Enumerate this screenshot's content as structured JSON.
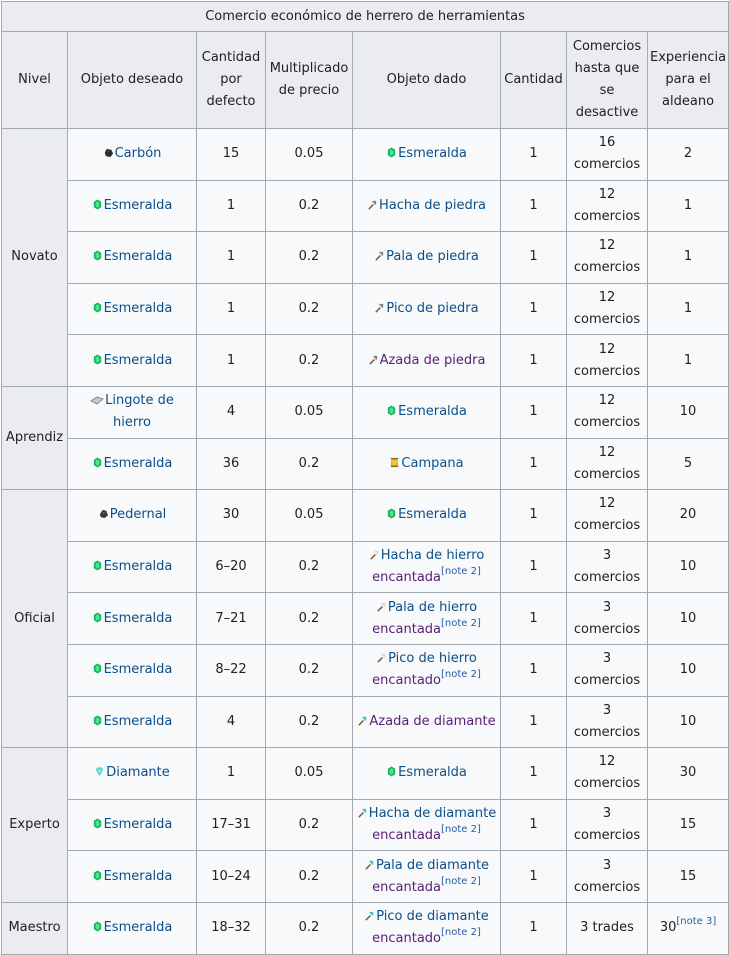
{
  "title": "Comercio económico de herrero de herramientas",
  "headers": {
    "nivel": "Nivel",
    "objeto_deseado": "Objeto deseado",
    "cantidad_defecto": [
      "Cantidad",
      "por",
      "defecto"
    ],
    "multiplicado": [
      "Multiplicado",
      "de precio"
    ],
    "objeto_dado": "Objeto dado",
    "cantidad": "Cantidad",
    "comercios": [
      "Comercios",
      "hasta que",
      "se",
      "desactive"
    ],
    "experiencia": [
      "Experiencia",
      "para el",
      "aldeano"
    ]
  },
  "levels": [
    {
      "name": "Novato",
      "rows": 5
    },
    {
      "name": "Aprendiz",
      "rows": 2
    },
    {
      "name": "Oficial",
      "rows": 5
    },
    {
      "name": "Experto",
      "rows": 3
    },
    {
      "name": "Maestro",
      "rows": 1
    }
  ],
  "rows": [
    {
      "wanted": "Carbón",
      "wanted_icon": "coal-icon",
      "default_qty": "15",
      "multiplier": "0.05",
      "given": "Esmeralda",
      "given_icon": "emerald-icon",
      "given_note": "",
      "qty": "1",
      "trades": [
        "16",
        "comercios"
      ],
      "xp": "2",
      "xp_note": ""
    },
    {
      "wanted": "Esmeralda",
      "wanted_icon": "emerald-icon",
      "default_qty": "1",
      "multiplier": "0.2",
      "given": "Hacha de piedra",
      "given_icon": "stone-axe-icon",
      "given_note": "",
      "qty": "1",
      "trades": [
        "12",
        "comercios"
      ],
      "xp": "1",
      "xp_note": ""
    },
    {
      "wanted": "Esmeralda",
      "wanted_icon": "emerald-icon",
      "default_qty": "1",
      "multiplier": "0.2",
      "given": "Pala de piedra",
      "given_icon": "stone-shovel-icon",
      "given_note": "",
      "qty": "1",
      "trades": [
        "12",
        "comercios"
      ],
      "xp": "1",
      "xp_note": ""
    },
    {
      "wanted": "Esmeralda",
      "wanted_icon": "emerald-icon",
      "default_qty": "1",
      "multiplier": "0.2",
      "given": "Pico de piedra",
      "given_icon": "stone-pickaxe-icon",
      "given_note": "",
      "qty": "1",
      "trades": [
        "12",
        "comercios"
      ],
      "xp": "1",
      "xp_note": ""
    },
    {
      "wanted": "Esmeralda",
      "wanted_icon": "emerald-icon",
      "default_qty": "1",
      "multiplier": "0.2",
      "given": "Azada de piedra",
      "given_icon": "stone-hoe-icon",
      "given_note": "",
      "qty": "1",
      "trades": [
        "12",
        "comercios"
      ],
      "xp": "1",
      "xp_note": "",
      "given_purple": true
    },
    {
      "wanted": "Lingote de hierro",
      "wanted_icon": "iron-ingot-icon",
      "default_qty": "4",
      "multiplier": "0.05",
      "given": "Esmeralda",
      "given_icon": "emerald-icon",
      "given_note": "",
      "qty": "1",
      "trades": [
        "12",
        "comercios"
      ],
      "xp": "10",
      "xp_note": ""
    },
    {
      "wanted": "Esmeralda",
      "wanted_icon": "emerald-icon",
      "default_qty": "36",
      "multiplier": "0.2",
      "given": "Campana",
      "given_icon": "bell-icon",
      "given_note": "",
      "qty": "1",
      "trades": [
        "12",
        "comercios"
      ],
      "xp": "5",
      "xp_note": ""
    },
    {
      "wanted": "Pedernal",
      "wanted_icon": "flint-icon",
      "default_qty": "30",
      "multiplier": "0.05",
      "given": "Esmeralda",
      "given_icon": "emerald-icon",
      "given_note": "",
      "qty": "1",
      "trades": [
        "12",
        "comercios"
      ],
      "xp": "20",
      "xp_note": ""
    },
    {
      "wanted": "Esmeralda",
      "wanted_icon": "emerald-icon",
      "default_qty": "6–20",
      "multiplier": "0.2",
      "given": [
        "Hacha de hierro",
        "encantada"
      ],
      "given_icon": "iron-axe-icon",
      "given_note": "[note 2]",
      "qty": "1",
      "trades": [
        "3",
        "comercios"
      ],
      "xp": "10",
      "xp_note": ""
    },
    {
      "wanted": "Esmeralda",
      "wanted_icon": "emerald-icon",
      "default_qty": "7–21",
      "multiplier": "0.2",
      "given": [
        "Pala de hierro",
        "encantada"
      ],
      "given_icon": "iron-shovel-icon",
      "given_note": "[note 2]",
      "qty": "1",
      "trades": [
        "3",
        "comercios"
      ],
      "xp": "10",
      "xp_note": ""
    },
    {
      "wanted": "Esmeralda",
      "wanted_icon": "emerald-icon",
      "default_qty": "8–22",
      "multiplier": "0.2",
      "given": [
        "Pico de hierro",
        "encantado"
      ],
      "given_icon": "iron-pickaxe-icon",
      "given_note": "[note 2]",
      "qty": "1",
      "trades": [
        "3",
        "comercios"
      ],
      "xp": "10",
      "xp_note": ""
    },
    {
      "wanted": "Esmeralda",
      "wanted_icon": "emerald-icon",
      "default_qty": "4",
      "multiplier": "0.2",
      "given": "Azada de diamante",
      "given_icon": "diamond-hoe-icon",
      "given_note": "",
      "qty": "1",
      "trades": [
        "3",
        "comercios"
      ],
      "xp": "10",
      "xp_note": "",
      "given_purple": true
    },
    {
      "wanted": "Diamante",
      "wanted_icon": "diamond-icon",
      "default_qty": "1",
      "multiplier": "0.05",
      "given": "Esmeralda",
      "given_icon": "emerald-icon",
      "given_note": "",
      "qty": "1",
      "trades": [
        "12",
        "comercios"
      ],
      "xp": "30",
      "xp_note": ""
    },
    {
      "wanted": "Esmeralda",
      "wanted_icon": "emerald-icon",
      "default_qty": "17–31",
      "multiplier": "0.2",
      "given": [
        "Hacha de diamante",
        "encantada"
      ],
      "given_icon": "diamond-axe-icon",
      "given_note": "[note 2]",
      "qty": "1",
      "trades": [
        "3",
        "comercios"
      ],
      "xp": "15",
      "xp_note": ""
    },
    {
      "wanted": "Esmeralda",
      "wanted_icon": "emerald-icon",
      "default_qty": "10–24",
      "multiplier": "0.2",
      "given": [
        "Pala de diamante",
        "encantada"
      ],
      "given_icon": "diamond-shovel-icon",
      "given_note": "[note 2]",
      "qty": "1",
      "trades": [
        "3",
        "comercios"
      ],
      "xp": "15",
      "xp_note": ""
    },
    {
      "wanted": "Esmeralda",
      "wanted_icon": "emerald-icon",
      "default_qty": "18–32",
      "multiplier": "0.2",
      "given": [
        "Pico de diamante",
        "encantado"
      ],
      "given_icon": "diamond-pickaxe-icon",
      "given_note": "[note 2]",
      "qty": "1",
      "trades": [
        "3 trades"
      ],
      "xp": "30",
      "xp_note": "[note 3]"
    }
  ],
  "colors": {
    "link": "#0b4e8a",
    "link_visited": "#5a2077",
    "header_bg": "#eaecf0",
    "cell_bg": "#f8f9fa",
    "border": "#a2a9b1"
  }
}
